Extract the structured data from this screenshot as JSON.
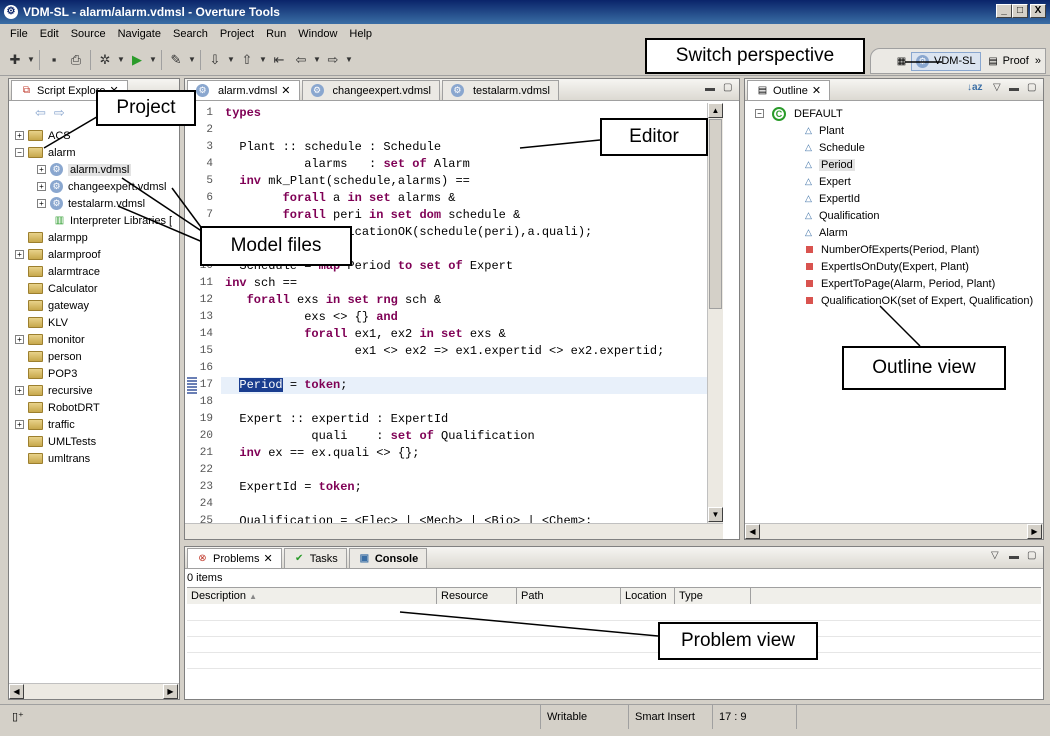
{
  "window": {
    "title": "VDM-SL - alarm/alarm.vdmsl - Overture Tools",
    "minimize": "_",
    "maximize": "□",
    "close": "X"
  },
  "menu": [
    "File",
    "Edit",
    "Source",
    "Navigate",
    "Search",
    "Project",
    "Run",
    "Window",
    "Help"
  ],
  "perspectives": {
    "vdmsl": "VDM-SL",
    "proof": "Proof",
    "overflow": "»"
  },
  "explorer": {
    "tab": "Script Explore",
    "projects": [
      {
        "name": "ACS",
        "exp": "+"
      },
      {
        "name": "alarm",
        "exp": "−"
      },
      {
        "name": "alarm.vdmsl",
        "file": true,
        "exp": "+"
      },
      {
        "name": "changeexpert.vdmsl",
        "file": true,
        "exp": "+"
      },
      {
        "name": "testalarm.vdmsl",
        "file": true,
        "exp": "+"
      },
      {
        "name": "Interpreter Libraries [",
        "lib": true
      },
      {
        "name": "alarmpp",
        "exp": ""
      },
      {
        "name": "alarmproof",
        "exp": "+"
      },
      {
        "name": "alarmtrace",
        "exp": ""
      },
      {
        "name": "Calculator",
        "exp": ""
      },
      {
        "name": "gateway",
        "exp": ""
      },
      {
        "name": "KLV",
        "exp": ""
      },
      {
        "name": "monitor",
        "exp": "+"
      },
      {
        "name": "person",
        "exp": ""
      },
      {
        "name": "POP3",
        "exp": ""
      },
      {
        "name": "recursive",
        "exp": "+"
      },
      {
        "name": "RobotDRT",
        "exp": ""
      },
      {
        "name": "traffic",
        "exp": "+"
      },
      {
        "name": "UMLTests",
        "exp": ""
      },
      {
        "name": "umltrans",
        "exp": ""
      }
    ]
  },
  "editor": {
    "tabs": [
      "alarm.vdmsl",
      "changeexpert.vdmsl",
      "testalarm.vdmsl"
    ],
    "lines": [
      {
        "n": "1",
        "html": "<span class='kw'>types</span>",
        "nohide": true
      },
      {
        "n": "2",
        "html": ""
      },
      {
        "n": "3",
        "html": "  Plant :: schedule : Schedule"
      },
      {
        "n": "4",
        "html": "           alarms   : <span class='kw'>set of</span> Alarm"
      },
      {
        "n": "5",
        "html": "  <span class='kw'>inv</span> mk_Plant(schedule,alarms) =="
      },
      {
        "n": "6",
        "html": "        <span class='kw'>forall</span> a <span class='kw'>in set</span> alarms &amp;"
      },
      {
        "n": "7",
        "html": "        <span class='kw'>forall</span> peri <span class='kw'>in set dom</span> schedule &amp;"
      },
      {
        "n": "8",
        "html": "           QualificationOK(schedule(peri),a.quali);"
      },
      {
        "n": "9",
        "html": ""
      },
      {
        "n": "10",
        "html": "  Schedule = <span class='kw'>map</span> Period <span class='kw'>to set of</span> Expert"
      },
      {
        "n": "11",
        "html": "<span class='kw'>inv</span> sch =="
      },
      {
        "n": "12",
        "html": "   <span class='kw'>forall</span> exs <span class='kw'>in set rng</span> sch &amp;"
      },
      {
        "n": "13",
        "html": "           exs &lt;&gt; {} <span class='kw'>and</span>"
      },
      {
        "n": "14",
        "html": "           <span class='kw'>forall</span> ex1, ex2 <span class='kw'>in set</span> exs &amp;"
      },
      {
        "n": "15",
        "html": "                  ex1 &lt;&gt; ex2 =&gt; ex1.expertid &lt;&gt; ex2.expertid;"
      },
      {
        "n": "16",
        "html": ""
      },
      {
        "n": "17",
        "html": "  <span style='background:#1a3d8f;color:#fff'>Period</span> = <span class='kw'>token</span>;",
        "hl": true
      },
      {
        "n": "18",
        "html": ""
      },
      {
        "n": "19",
        "html": "  Expert :: expertid : ExpertId"
      },
      {
        "n": "20",
        "html": "            quali    : <span class='kw'>set of</span> Qualification"
      },
      {
        "n": "21",
        "html": "  <span class='kw'>inv</span> ex == ex.quali &lt;&gt; {};"
      },
      {
        "n": "22",
        "html": ""
      },
      {
        "n": "23",
        "html": "  ExpertId = <span class='kw'>token</span>;"
      },
      {
        "n": "24",
        "html": ""
      },
      {
        "n": "25",
        "html": "  Qualification = &lt;Elec&gt; | &lt;Mech&gt; | &lt;Bio&gt; | &lt;Chem&gt;;"
      }
    ]
  },
  "outline": {
    "tab": "Outline",
    "root": "DEFAULT",
    "types": [
      "Plant",
      "Schedule",
      "Period",
      "Expert",
      "ExpertId",
      "Qualification",
      "Alarm"
    ],
    "functions": [
      "NumberOfExperts(Period, Plant)",
      "ExpertIsOnDuty(Expert, Plant)",
      "ExpertToPage(Alarm, Period, Plant)",
      "QualificationOK(set of Expert, Qualification)"
    ]
  },
  "problems": {
    "tabs": [
      "Problems",
      "Tasks",
      "Console"
    ],
    "count": "0 items",
    "columns": [
      "Description",
      "Resource",
      "Path",
      "Location",
      "Type"
    ]
  },
  "status": {
    "writable": "Writable",
    "insert": "Smart Insert",
    "position": "17 : 9"
  },
  "callouts": {
    "perspective": "Switch perspective",
    "project": "Project",
    "editor": "Editor",
    "model": "Model files",
    "outline": "Outline view",
    "problem": "Problem view"
  }
}
